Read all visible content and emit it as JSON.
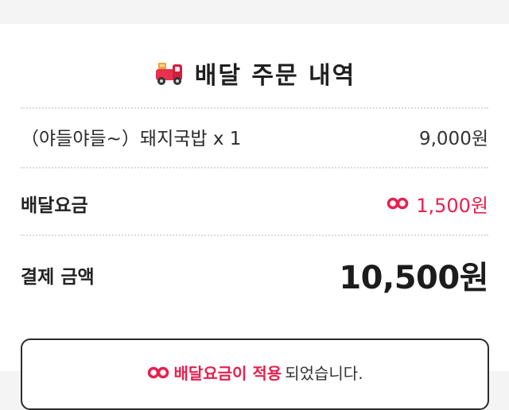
{
  "title": "배달 주문 내역",
  "items": [
    {
      "name": "（야들야들~）돼지국밥 x 1",
      "price": "9,000원"
    }
  ],
  "fee": {
    "label": "배달요금",
    "value": "1,500원"
  },
  "total": {
    "label": "결제 금액",
    "value": "10,500원"
  },
  "notice": {
    "highlight": "배달요금이 적용",
    "rest": "되었습니다."
  },
  "colors": {
    "accent": "#e8204e",
    "text": "#222222",
    "divider": "#dcdcdc"
  },
  "icons": {
    "title": "delivery-truck-icon",
    "fee": "coupon-link-icon"
  }
}
